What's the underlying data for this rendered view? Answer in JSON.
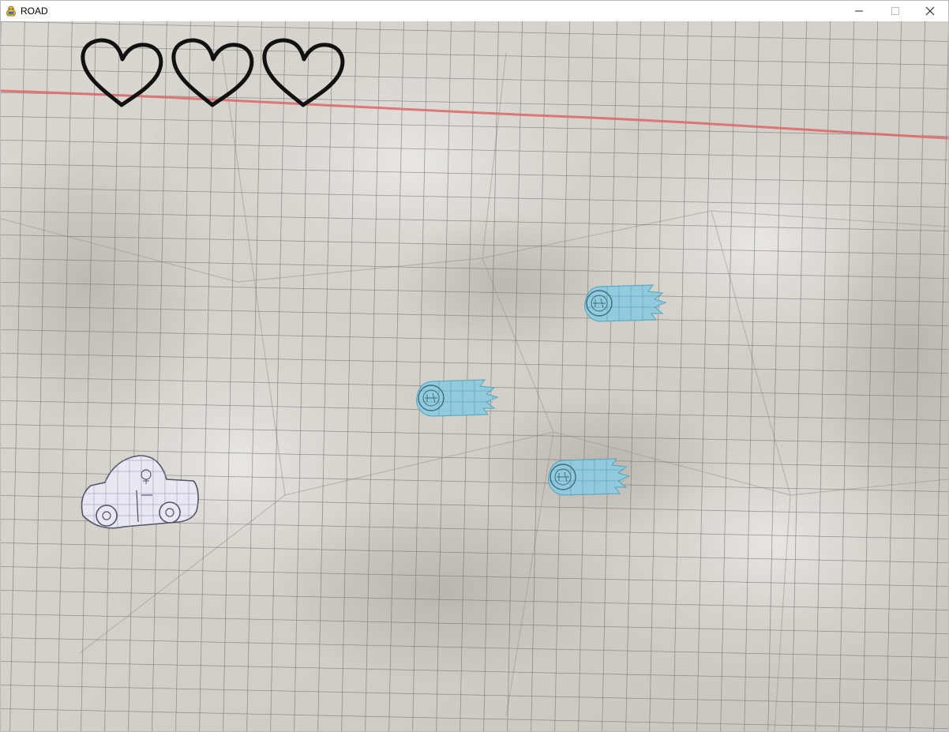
{
  "window": {
    "title": "ROAD",
    "app_icon": "pygame-snake-icon",
    "controls": {
      "minimize": "minimize-icon",
      "maximize": "maximize-icon",
      "close": "close-icon"
    }
  },
  "game": {
    "background": "crumpled-graph-paper",
    "lives": {
      "count": 3,
      "icon": "heart-outline-icon"
    },
    "player": {
      "sprite": "hand-drawn-car"
    },
    "obstacles": [
      {
        "sprite": "blue-comet-icon"
      },
      {
        "sprite": "blue-comet-icon"
      },
      {
        "sprite": "blue-comet-icon"
      }
    ],
    "colors": {
      "paper": "#d9d6d0",
      "grid": "#6e6e6e",
      "margin_line": "#d9666a",
      "comet": "#8fcbe0",
      "car_fill": "#e8e8f2"
    }
  }
}
